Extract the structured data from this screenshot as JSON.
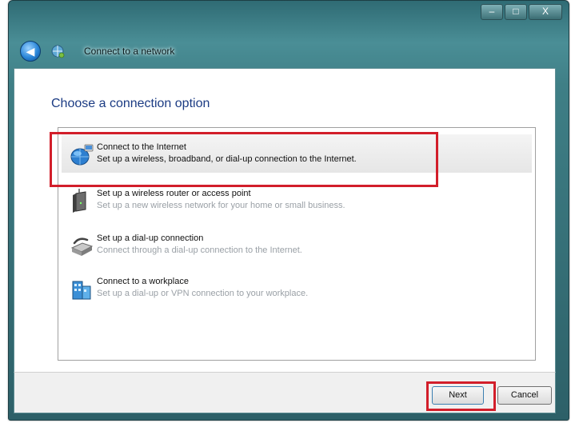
{
  "window": {
    "title": "Connect to a network",
    "caption_controls": {
      "minimize": "–",
      "maximize": "□",
      "close": "X"
    },
    "back_glyph": "◀"
  },
  "page": {
    "heading": "Choose a connection option"
  },
  "options": [
    {
      "title": "Connect to the Internet",
      "description": "Set up a wireless, broadband, or dial-up connection to the Internet.",
      "icon": "globe-network-icon",
      "selected": true
    },
    {
      "title": "Set up a wireless router or access point",
      "description": "Set up a new wireless network for your home or small business.",
      "icon": "wireless-router-icon",
      "selected": false
    },
    {
      "title": "Set up a dial-up connection",
      "description": "Connect through a dial-up connection to the Internet.",
      "icon": "dialup-modem-icon",
      "selected": false
    },
    {
      "title": "Connect to a workplace",
      "description": "Set up a dial-up or VPN connection to your workplace.",
      "icon": "workplace-vpn-icon",
      "selected": false
    }
  ],
  "buttons": {
    "next": "Next",
    "cancel": "Cancel"
  },
  "annotations": {
    "highlight_color": "#d21e2a"
  },
  "colors": {
    "heading": "#1b3b83",
    "titlebar": "#3f7f86"
  }
}
